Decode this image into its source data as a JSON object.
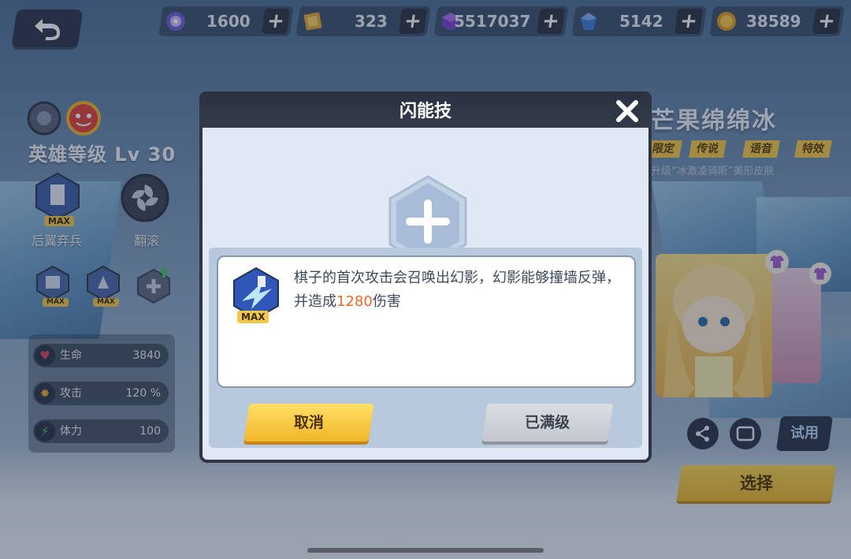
{
  "resources": [
    {
      "name": "energy",
      "icon": "orb-icon",
      "value": "1600"
    },
    {
      "name": "card",
      "icon": "card-icon",
      "value": "323"
    },
    {
      "name": "purple-cube",
      "icon": "purple-cube-icon",
      "value": "5517037"
    },
    {
      "name": "blue-gem",
      "icon": "blue-gem-icon",
      "value": "5142"
    },
    {
      "name": "gold",
      "icon": "coin-icon",
      "value": "38589"
    }
  ],
  "left_panel": {
    "hero_level": "英雄等级 Lv 30",
    "skill_1_label": "后翼弃兵",
    "skill_2_label": "翻滚",
    "max_label": "MAX",
    "stats": [
      {
        "label": "生命",
        "value": "3840",
        "icon": "heart-icon"
      },
      {
        "label": "攻击",
        "value": "120 %",
        "icon": "attack-icon"
      },
      {
        "label": "体力",
        "value": "100",
        "icon": "lightning-icon"
      }
    ]
  },
  "right_panel": {
    "skin_title": "芒果绵绵冰",
    "tags": [
      "限定",
      "传说",
      "语音",
      "特效"
    ],
    "description": "升级“冰激凌骑斯”美形皮肤",
    "try_label": "试用",
    "select_label": "选择"
  },
  "modal": {
    "title": "闪能技",
    "description_before": "棋子的首次攻击会召唤出幻影，幻影能够撞墙反弹，并造成",
    "damage": "1280",
    "description_after": "伤害",
    "skill_max_label": "MAX",
    "cancel_label": "取消",
    "maxed_label": "已满级"
  },
  "colors": {
    "accent_yellow": "#f2b52b",
    "highlight_orange": "#ee6a2a",
    "dark_panel": "#2e3544"
  }
}
